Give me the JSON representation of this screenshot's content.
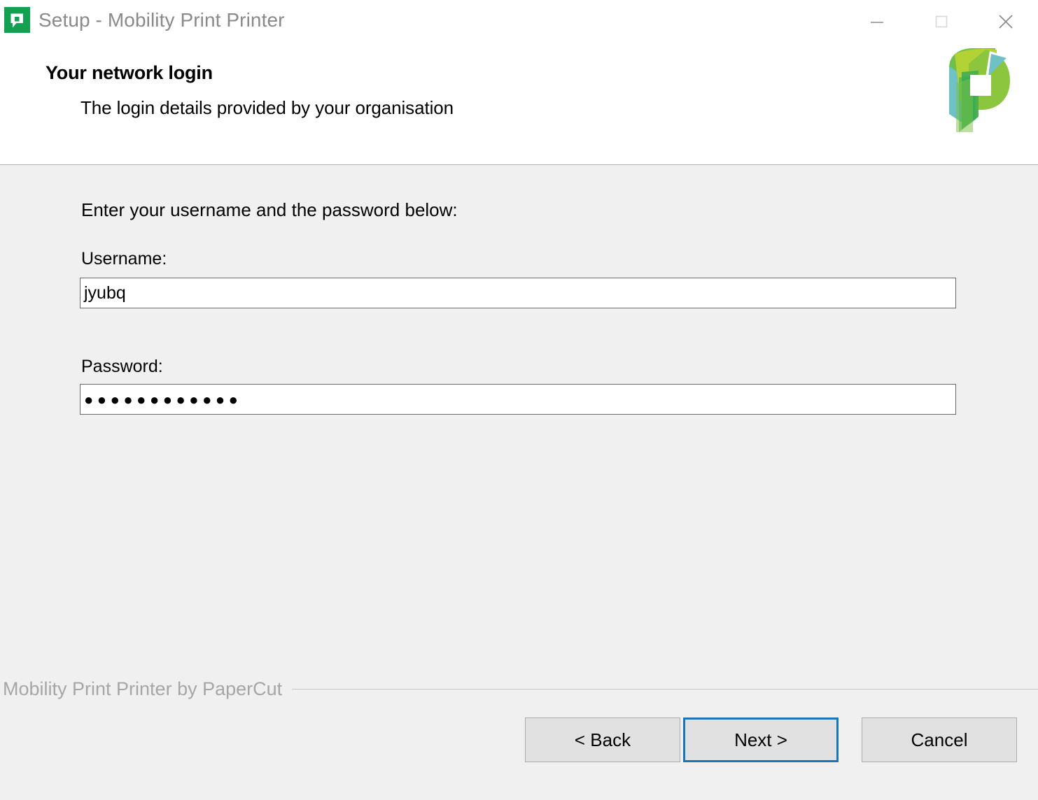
{
  "window": {
    "title": "Setup - Mobility Print Printer",
    "app_icon": "papercut-p-icon",
    "controls": {
      "minimize": "minimize-icon",
      "maximize": "maximize-icon",
      "close": "close-icon"
    }
  },
  "header": {
    "heading": "Your network login",
    "subheading": "The login details provided by your organisation",
    "logo": "papercut-logo"
  },
  "main": {
    "instruction": "Enter your username and the password below:",
    "fields": [
      {
        "label": "Username:",
        "value": "jyubq",
        "placeholder": ""
      },
      {
        "label": "Password:",
        "value": "●●●●●●●●●●●●",
        "placeholder": "",
        "masked_character_count": 12
      }
    ]
  },
  "footer": {
    "brand": "Mobility Print Printer by PaperCut",
    "buttons": {
      "back": "< Back",
      "next": "Next >",
      "cancel": "Cancel"
    },
    "focused_button": "next"
  },
  "colors": {
    "accent_green": "#12a150",
    "focus_blue": "#1a76ba",
    "window_background": "#f0f0f0",
    "header_background": "#ffffff",
    "title_text": "#8a8a8a",
    "footer_brand_text": "#a6a6a6",
    "button_face": "#e1e1e1"
  }
}
